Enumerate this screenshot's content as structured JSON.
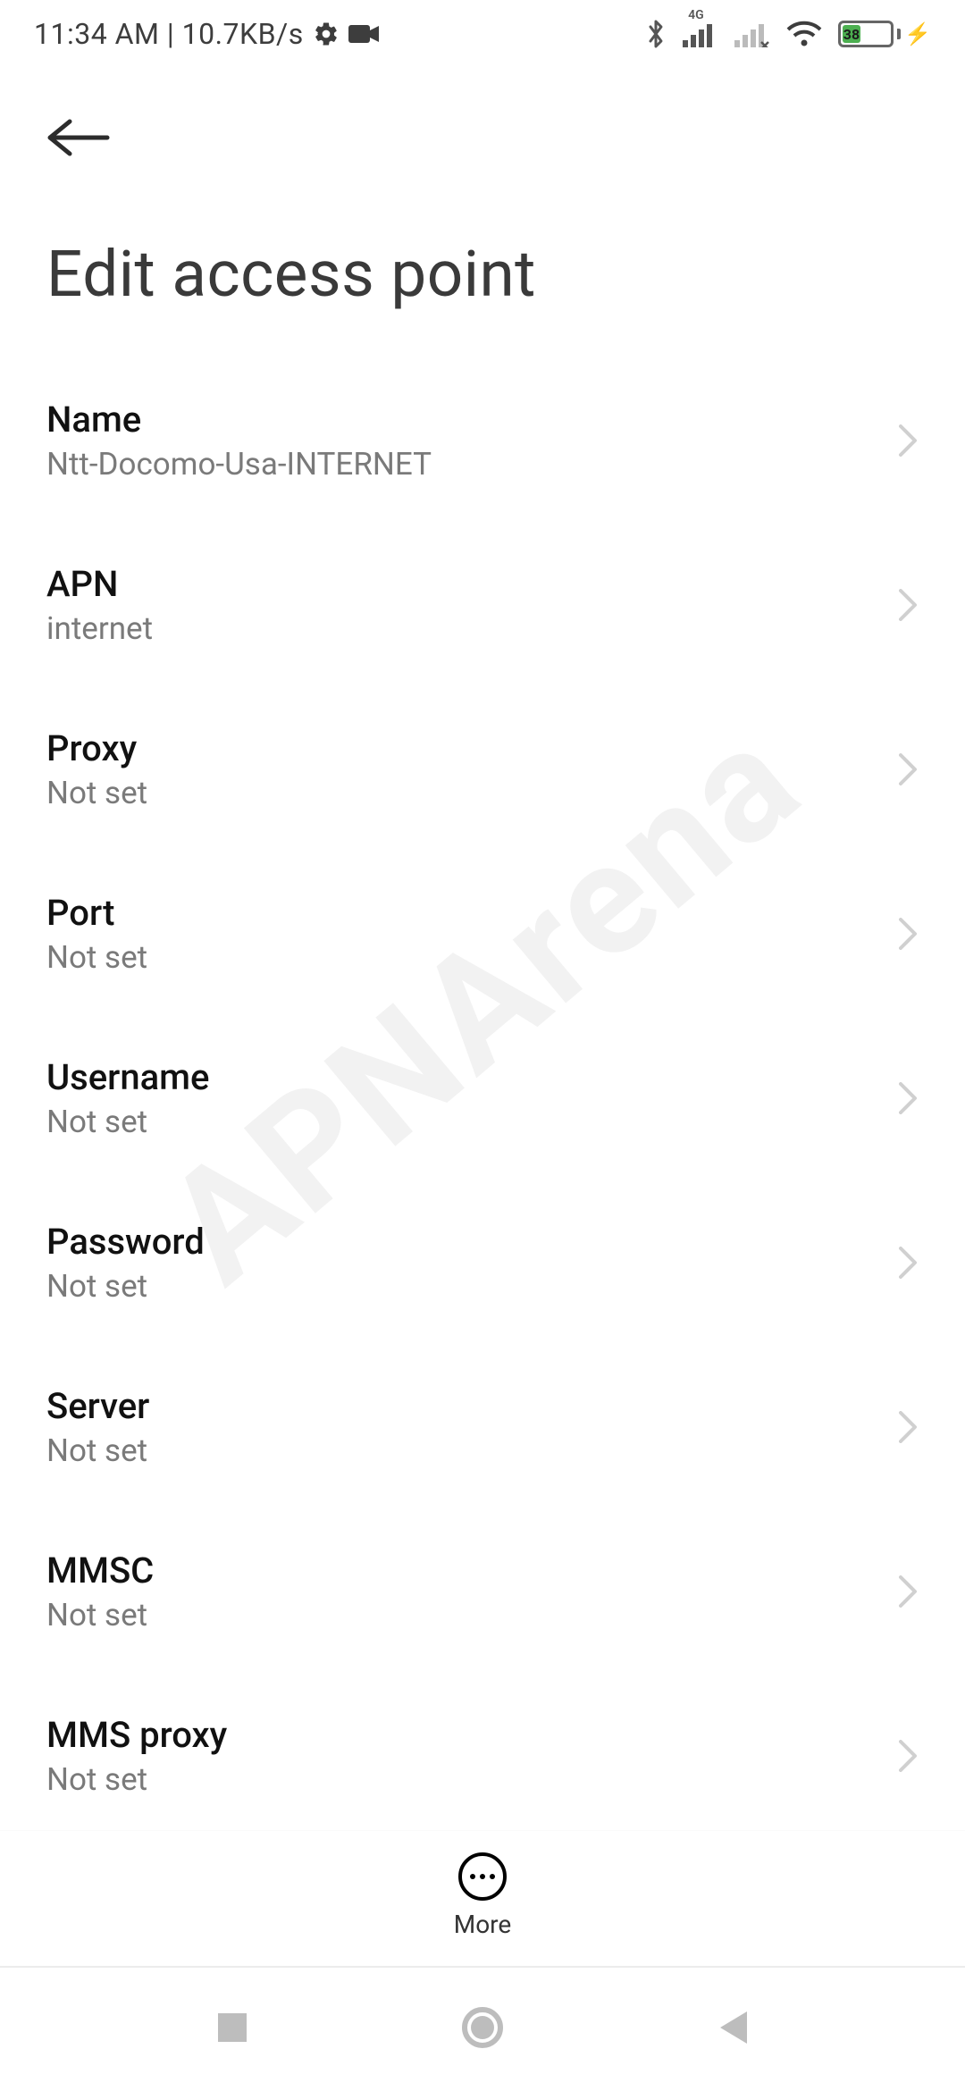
{
  "status": {
    "time": "11:34 AM",
    "separator": "|",
    "net_speed": "10.7KB/s",
    "indicators": {
      "settings_icon": "gear-icon",
      "camera_icon": "video-camera-icon",
      "bluetooth_icon": "bluetooth-icon",
      "signal_label": "4G",
      "wifi_icon": "wifi-icon"
    },
    "battery": {
      "percent": "38",
      "charging": true
    }
  },
  "header": {
    "back_icon": "arrow-left-icon"
  },
  "title": "Edit access point",
  "settings": [
    {
      "label": "Name",
      "value": "Ntt-Docomo-Usa-INTERNET"
    },
    {
      "label": "APN",
      "value": "internet"
    },
    {
      "label": "Proxy",
      "value": "Not set"
    },
    {
      "label": "Port",
      "value": "Not set"
    },
    {
      "label": "Username",
      "value": "Not set"
    },
    {
      "label": "Password",
      "value": "Not set"
    },
    {
      "label": "Server",
      "value": "Not set"
    },
    {
      "label": "MMSC",
      "value": "Not set"
    },
    {
      "label": "MMS proxy",
      "value": "Not set"
    }
  ],
  "bottom_action": {
    "icon": "more-horizontal-icon",
    "label": "More"
  },
  "nav": {
    "recents_icon": "square-icon",
    "home_icon": "circle-icon",
    "back_icon": "triangle-left-icon"
  },
  "watermark": "APNArena"
}
